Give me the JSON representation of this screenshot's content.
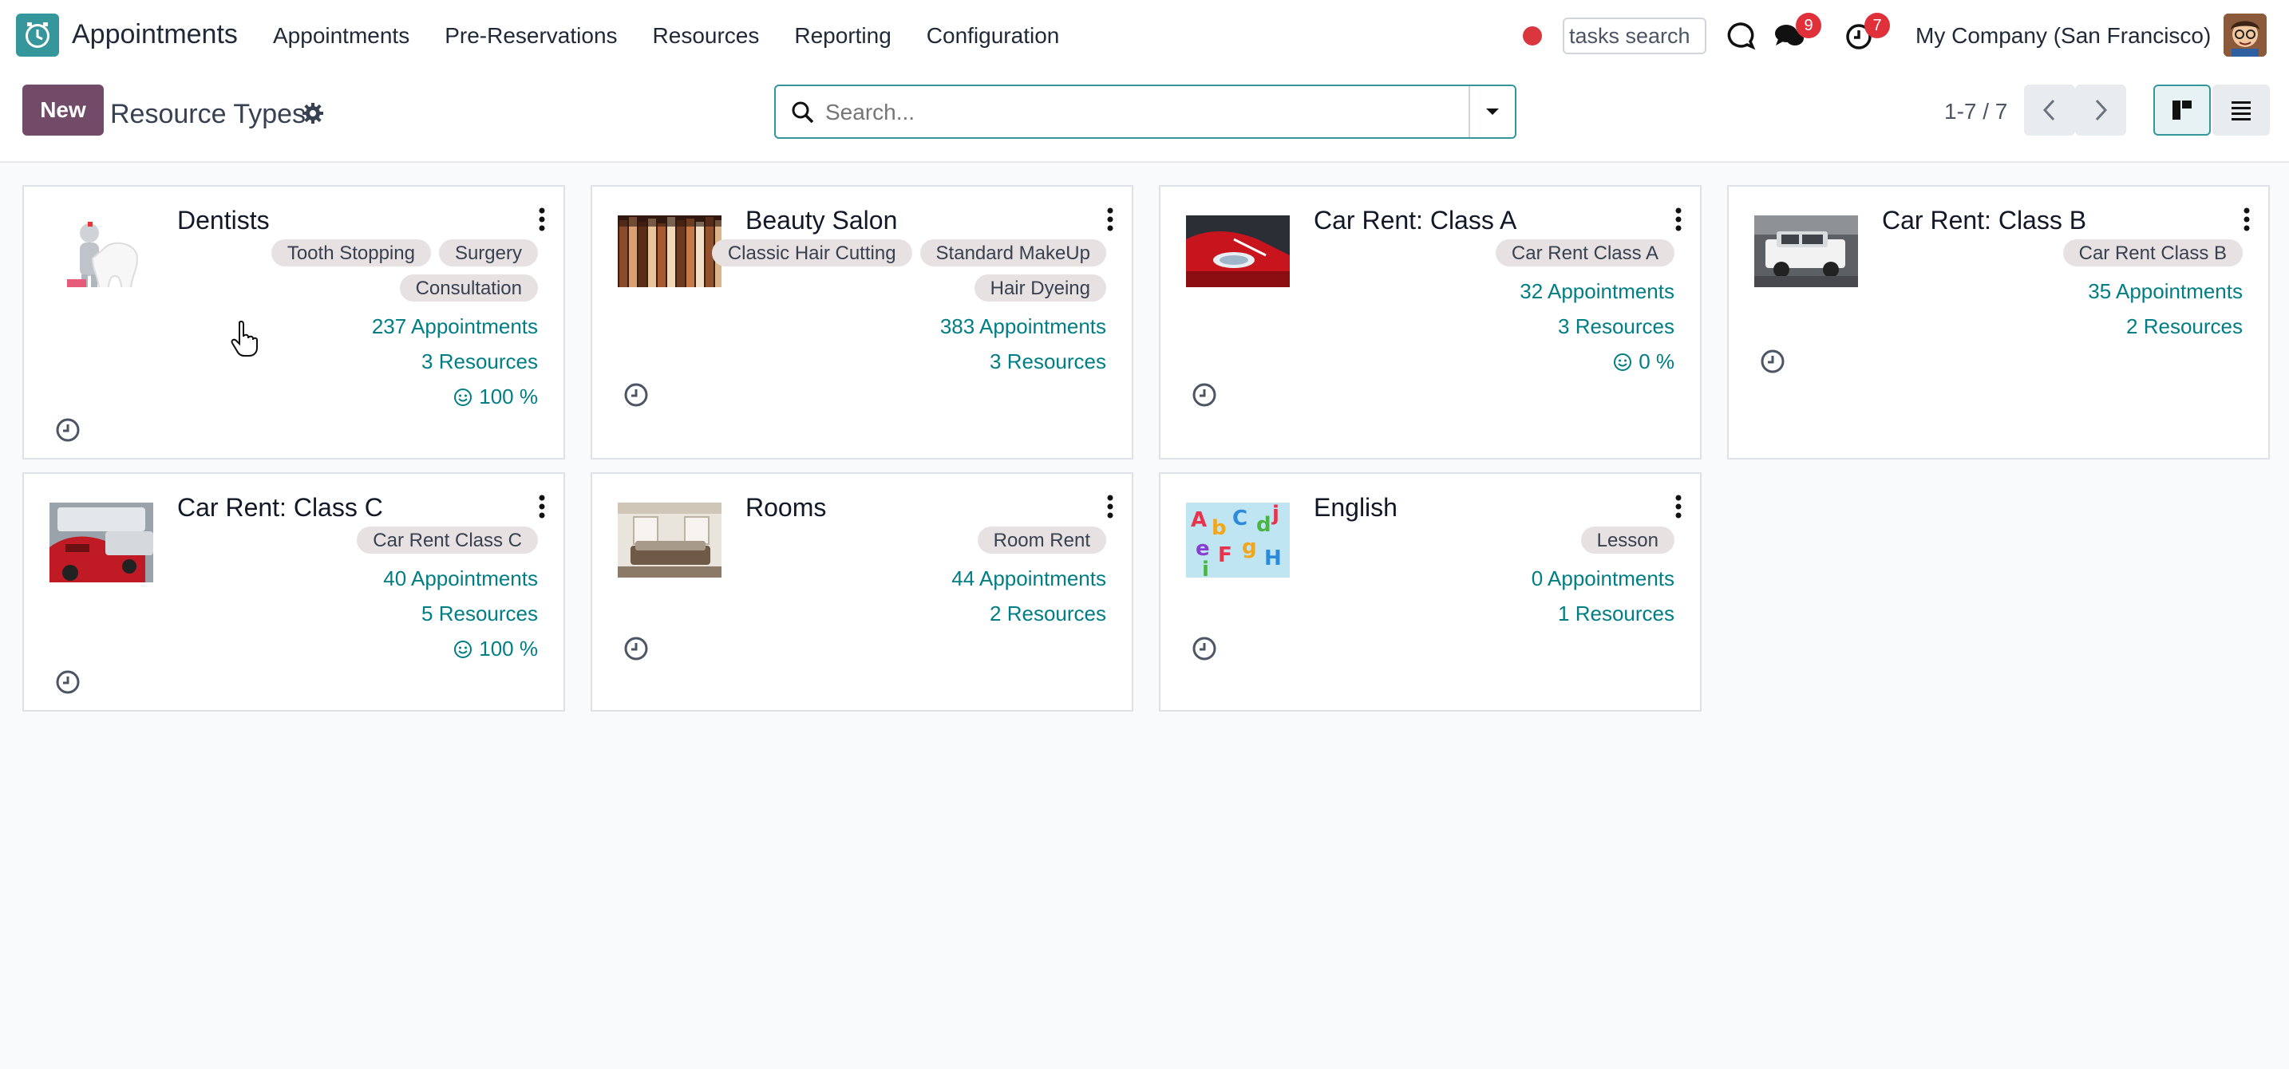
{
  "navbar": {
    "app_name": "Appointments",
    "menu": [
      "Appointments",
      "Pre-Reservations",
      "Resources",
      "Reporting",
      "Configuration"
    ],
    "tasks_search_value": "tasks search",
    "messages_badge": "9",
    "activities_badge": "7",
    "company": "My Company (San Francisco)"
  },
  "control": {
    "new_label": "New",
    "title": "Resource Types",
    "search_placeholder": "Search...",
    "pager": "1-7 / 7"
  },
  "cards": [
    {
      "title": "Dentists",
      "tags": [
        "Tooth Stopping",
        "Surgery",
        "Consultation"
      ],
      "appointments": "237 Appointments",
      "resources": "3 Resources",
      "rating": "100 %"
    },
    {
      "title": "Beauty Salon",
      "tags": [
        "Classic Hair Cutting",
        "Standard MakeUp",
        "Hair Dyeing"
      ],
      "appointments": "383 Appointments",
      "resources": "3 Resources",
      "rating": ""
    },
    {
      "title": "Car Rent: Class A",
      "tags": [
        "Car Rent Class A"
      ],
      "appointments": "32 Appointments",
      "resources": "3 Resources",
      "rating": "0 %"
    },
    {
      "title": "Car Rent: Class B",
      "tags": [
        "Car Rent Class B"
      ],
      "appointments": "35 Appointments",
      "resources": "2 Resources",
      "rating": ""
    },
    {
      "title": "Car Rent: Class C",
      "tags": [
        "Car Rent Class C"
      ],
      "appointments": "40 Appointments",
      "resources": "5 Resources",
      "rating": "100 %"
    },
    {
      "title": "Rooms",
      "tags": [
        "Room Rent"
      ],
      "appointments": "44 Appointments",
      "resources": "2 Resources",
      "rating": ""
    },
    {
      "title": "English",
      "tags": [
        "Lesson"
      ],
      "appointments": "0 Appointments",
      "resources": "1 Resources",
      "rating": ""
    }
  ],
  "colors": {
    "brand": "#714b67",
    "link": "#017e84",
    "accent": "#35979c",
    "badge": "#e0303a"
  }
}
